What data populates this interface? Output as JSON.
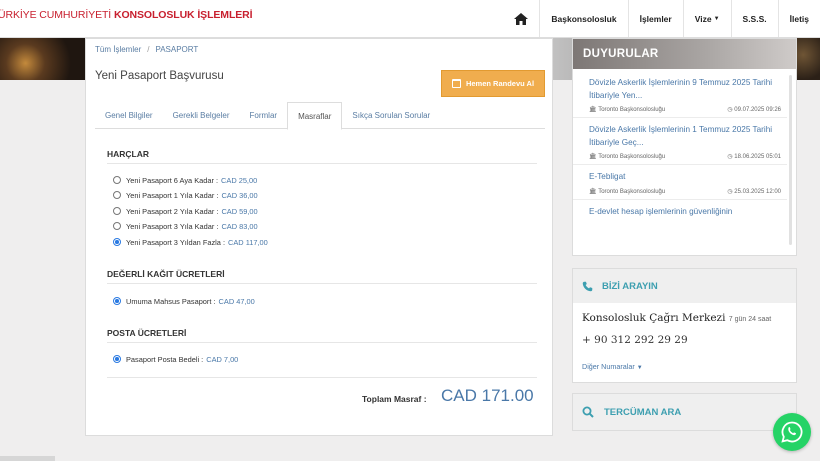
{
  "header": {
    "brand_plain": "ÜRKİYE CUMHURİYETİ",
    "brand_bold": "KONSOLOSLUK İŞLEMLERİ",
    "nav": [
      {
        "label": "Başkonsolosluk"
      },
      {
        "label": "İşlemler"
      },
      {
        "label": "Vize",
        "dropdown": true
      },
      {
        "label": "S.S.S."
      },
      {
        "label": "İletiş"
      }
    ]
  },
  "breadcrumb": {
    "all": "Tüm İşlemler",
    "sep": "/",
    "current": "PASAPORT"
  },
  "page": {
    "title": "Yeni Pasaport Başvurusu",
    "appointment_button": "Hemen Randevu Al"
  },
  "tabs": [
    {
      "label": "Genel Bilgiler",
      "active": false
    },
    {
      "label": "Gerekli Belgeler",
      "active": false
    },
    {
      "label": "Formlar",
      "active": false
    },
    {
      "label": "Masraflar",
      "active": true
    },
    {
      "label": "Sıkça Sorulan Sorular",
      "active": false
    }
  ],
  "fees": {
    "harclar": {
      "heading": "HARÇLAR",
      "options": [
        {
          "label": "Yeni Pasaport 6 Aya Kadar :",
          "price": "CAD 25,00",
          "selected": false
        },
        {
          "label": "Yeni Pasaport 1 Yıla Kadar :",
          "price": "CAD 36,00",
          "selected": false
        },
        {
          "label": "Yeni Pasaport 2 Yıla Kadar :",
          "price": "CAD 59,00",
          "selected": false
        },
        {
          "label": "Yeni Pasaport 3 Yıla Kadar :",
          "price": "CAD 83,00",
          "selected": false
        },
        {
          "label": "Yeni Pasaport 3 Yıldan Fazla :",
          "price": "CAD 117,00",
          "selected": true
        }
      ]
    },
    "kagit": {
      "heading": "DEĞERLİ KAĞIT ÜCRETLERİ",
      "options": [
        {
          "label": "Umuma Mahsus Pasaport :",
          "price": "CAD 47,00",
          "selected": true
        }
      ]
    },
    "posta": {
      "heading": "POSTA ÜCRETLERİ",
      "options": [
        {
          "label": "Pasaport Posta Bedeli :",
          "price": "CAD 7,00",
          "selected": true
        }
      ]
    },
    "total_label": "Toplam Masraf :",
    "total_value": "CAD 171.00"
  },
  "announcements": {
    "heading": "DUYURULAR",
    "items": [
      {
        "title": "Dövizle Askerlik İşlemlerinin 9 Temmuz 2025 Tarihi İtibariyle Yen...",
        "source": "Toronto Başkonsolosluğu",
        "date": "09.07.2025 09:26"
      },
      {
        "title": "Dövizle Askerlik İşlemlerinin 1 Temmuz 2025 Tarihi İtibariyle Geç...",
        "source": "Toronto Başkonsolosluğu",
        "date": "18.06.2025 05:01"
      },
      {
        "title": "E-Tebligat",
        "source": "Toronto Başkonsolosluğu",
        "date": "25.03.2025 12:00"
      },
      {
        "title": "E-devlet hesap işlemlerinin güvenliğinin",
        "source": "",
        "date": ""
      }
    ]
  },
  "call_us": {
    "heading": "BİZİ ARAYIN",
    "center": "Konsolosluk Çağrı Merkezi",
    "hours": "7 gün 24 saat",
    "phone": "+ 90 312 292 29 29",
    "more": "Diğer Numaralar"
  },
  "translator": {
    "label": "TERCÜMAN ARA"
  },
  "colors": {
    "accent": "#f0ad4e",
    "link": "#4a78a8",
    "brand": "#c8202f",
    "teal": "#3d9fb0",
    "whatsapp": "#25d366"
  }
}
